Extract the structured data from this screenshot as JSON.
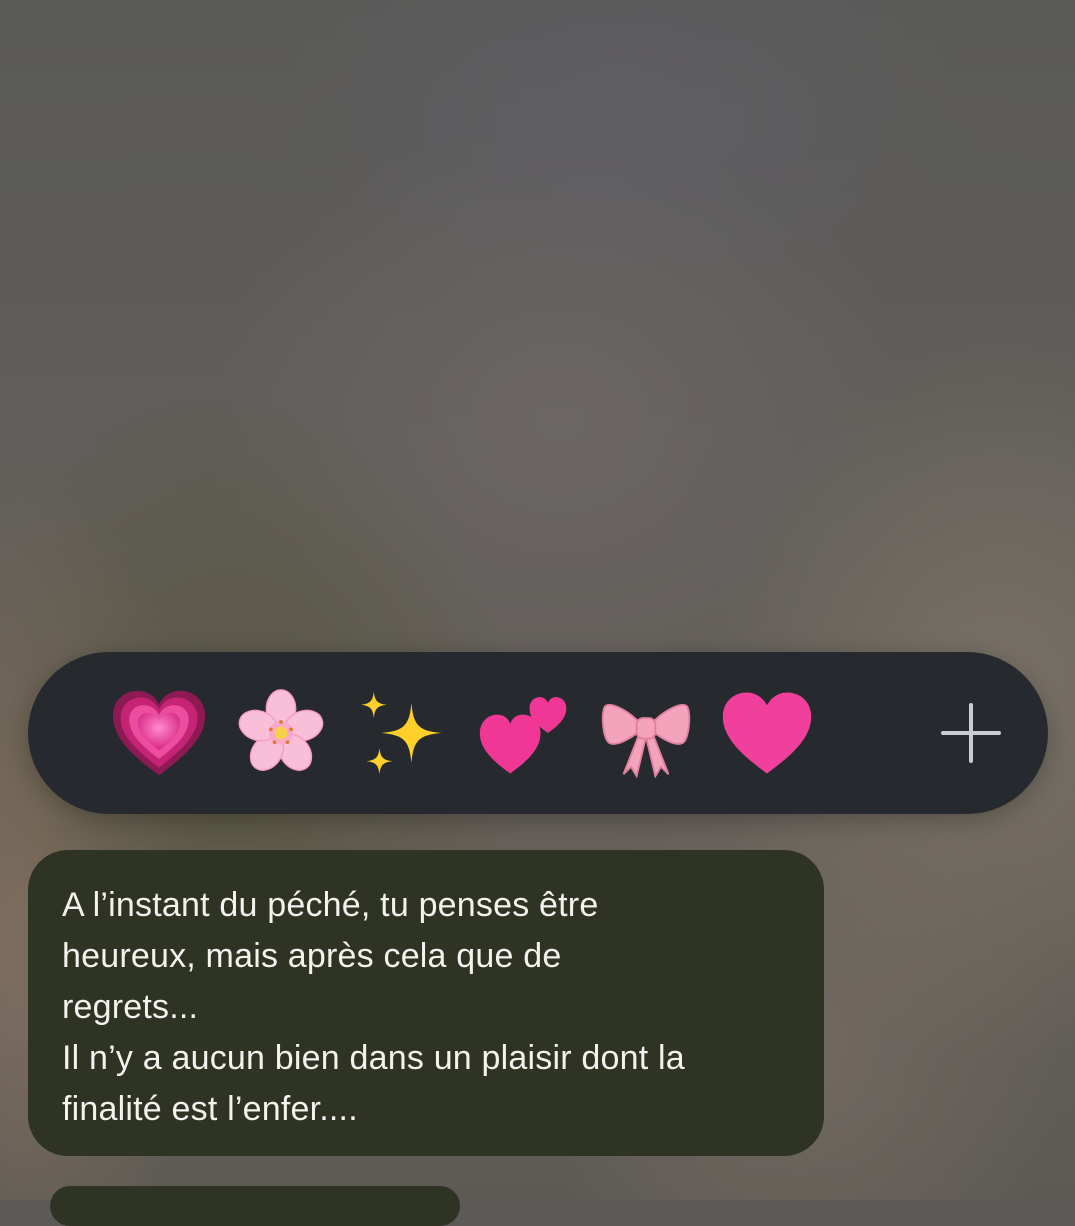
{
  "reactions": [
    {
      "name": "growing-heart-icon",
      "label": "growing heart"
    },
    {
      "name": "cherry-blossom-icon",
      "label": "cherry blossom"
    },
    {
      "name": "sparkles-icon",
      "label": "sparkles"
    },
    {
      "name": "two-hearts-icon",
      "label": "two hearts"
    },
    {
      "name": "ribbon-bow-icon",
      "label": "ribbon"
    },
    {
      "name": "pink-heart-icon",
      "label": "pink heart"
    },
    {
      "name": "plus-icon",
      "label": "add reaction"
    }
  ],
  "message": {
    "lines": [
      "A l’instant du péché, tu penses être",
      "heureux, mais après cela que de",
      "regrets...",
      "Il n’y a aucun bien dans un plaisir dont la",
      "finalité est l’enfer...."
    ]
  },
  "colors": {
    "reaction_bar": "#262a2e",
    "bubble": "#2e3324",
    "text": "#f2f2ee",
    "pink": "#f0409c",
    "plus": "#c9cdd2"
  }
}
